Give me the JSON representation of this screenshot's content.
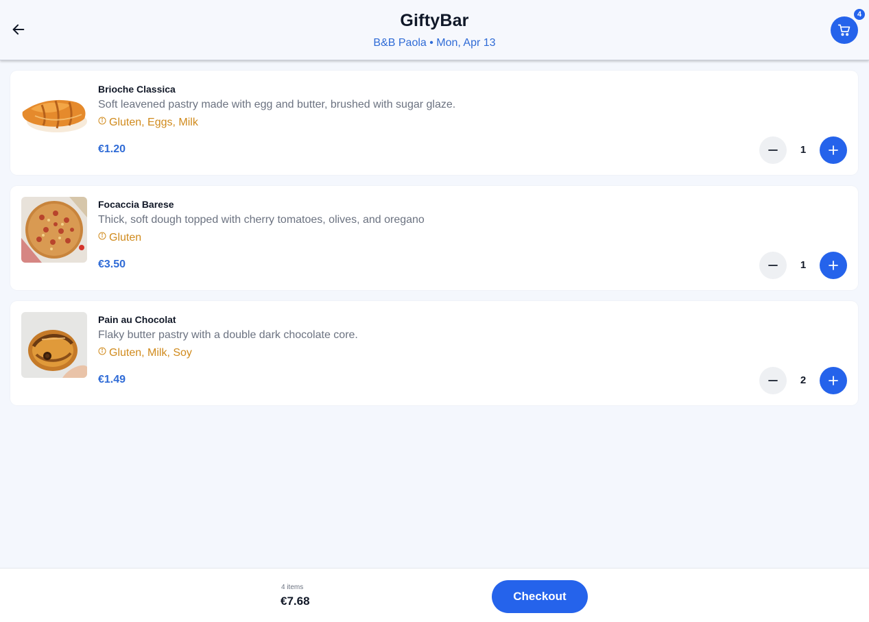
{
  "header": {
    "title": "GiftyBar",
    "subtitle": "B&B Paola • Mon, Apr 13",
    "cart_count": "4",
    "back_icon": "arrow-left-icon",
    "cart_icon": "cart-icon"
  },
  "products": [
    {
      "name": "Brioche Classica",
      "description": "Soft leavened pastry made with egg and butter, brushed with sugar glaze.",
      "allergens": "Gluten, Eggs, Milk",
      "price": "€1.20",
      "quantity": "1",
      "image": "croissant"
    },
    {
      "name": "Focaccia Barese",
      "description": "Thick, soft dough topped with cherry tomatoes, olives, and oregano",
      "allergens": "Gluten",
      "price": "€3.50",
      "quantity": "1",
      "image": "focaccia"
    },
    {
      "name": "Pain au Chocolat",
      "description": "Flaky butter pastry with a double dark chocolate core.",
      "allergens": "Gluten, Milk, Soy",
      "price": "€1.49",
      "quantity": "2",
      "image": "pain-au-chocolat"
    }
  ],
  "footer": {
    "items_count": "4 items",
    "total": "€7.68",
    "checkout_label": "Checkout"
  },
  "colors": {
    "accent": "#2563eb",
    "price": "#2f6bd6",
    "allergen": "#d08a1c",
    "background": "#f4f7fd"
  }
}
